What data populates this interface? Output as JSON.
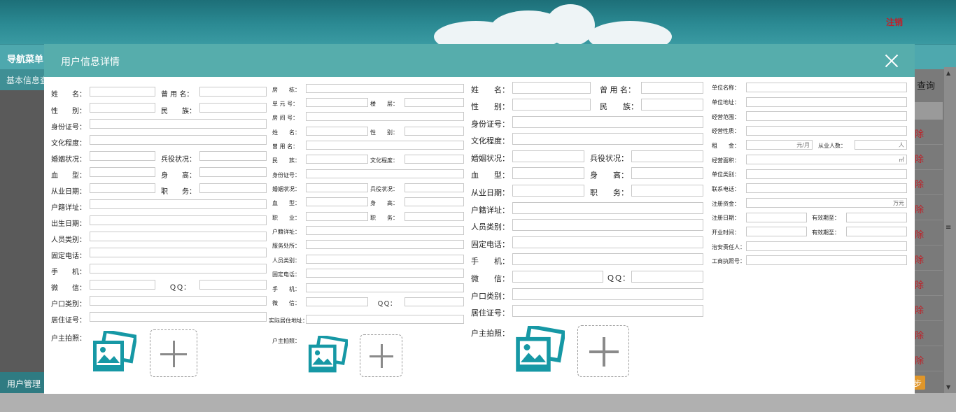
{
  "header": {
    "logout": "注销"
  },
  "nav": {
    "title": "导航菜单",
    "side_item": "基本信息查",
    "side_bottom": "用户管理"
  },
  "right": {
    "query": "查询",
    "delete": "除",
    "page_btn": "步"
  },
  "modal": {
    "title": "用户信息详情"
  },
  "col1": {
    "name": "姓　　名：",
    "alias": "曾 用 名：",
    "gender": "性　　别：",
    "ethnic": "民　　族：",
    "idno": "身份证号：",
    "education": "文化程度：",
    "marriage": "婚姻状况：",
    "military": "兵役状况：",
    "blood": "血　　型：",
    "height": "身　　高：",
    "work_date": "从业日期：",
    "duty": "职　　务：",
    "domicile": "户籍详址：",
    "birth": "出生日期：",
    "category": "人员类别：",
    "phone": "固定电话：",
    "mobile": "手　　机：",
    "wechat": "微　　信：",
    "qq": "ＱＱ：",
    "hukou_type": "户口类别：",
    "residence": "居住证号：",
    "photo": "户主拍照："
  },
  "col2": {
    "house": "房　　栋：",
    "unit": "单 元 号：",
    "floor": "楼　　层：",
    "room": "房 间 号：",
    "name": "姓　　名：",
    "gender": "性　　别：",
    "alias": "曾 用 名：",
    "ethnic": "民　　族：",
    "education": "文化程度：",
    "idno": "身份证号：",
    "marriage": "婚姻状况：",
    "military": "兵役状况：",
    "blood": "血　　型：",
    "height": "身　　高：",
    "job": "职　　业：",
    "duty": "职　　务：",
    "domicile": "户籍详址：",
    "service": "服务处所：",
    "category": "人员类别：",
    "phone": "固定电话：",
    "mobile": "手　　机：",
    "wechat": "微　　信：",
    "qq": "ＱＱ：",
    "actual_addr": "实际居住地址：",
    "photo": "户主拍照："
  },
  "col3": {
    "name": "姓　　名：",
    "alias": "曾 用 名：",
    "gender": "性　　别：",
    "ethnic": "民　　族：",
    "idno": "身份证号：",
    "education": "文化程度：",
    "marriage": "婚姻状况：",
    "military": "兵役状况：",
    "blood": "血　　型：",
    "height": "身　　高：",
    "work_date": "从业日期：",
    "duty": "职　　务：",
    "domicile": "户籍详址：",
    "category": "人员类别：",
    "phone": "固定电话：",
    "mobile": "手　　机：",
    "wechat": "微　　信：",
    "qq": "ＱＱ：",
    "hukou_type": "户口类别：",
    "residence": "居住证号：",
    "photo": "户主拍照："
  },
  "col4": {
    "unit_name": "单位名称：",
    "unit_addr": "单位地址：",
    "scope": "经营范围：",
    "nature": "经营性质：",
    "rent": "租　　金：",
    "rent_unit": "元/月",
    "staff": "从业人数：",
    "staff_unit": "人",
    "area": "经营面积：",
    "area_unit": "㎡",
    "unit_type": "单位类别：",
    "contact": "联系电话：",
    "capital": "注册资金：",
    "capital_unit": "万元",
    "reg_date": "注册日期：",
    "valid1": "有效期至：",
    "open_time": "开业时间：",
    "valid2": "有效期至：",
    "security": "治安责任人：",
    "license": "工商执照号："
  },
  "colors": {
    "accent": "#56adac",
    "icon": "#1698a5",
    "danger": "#c01e25"
  },
  "icons": {
    "photo": "photo-gallery-icon",
    "add": "plus-icon",
    "close": "close-icon"
  }
}
